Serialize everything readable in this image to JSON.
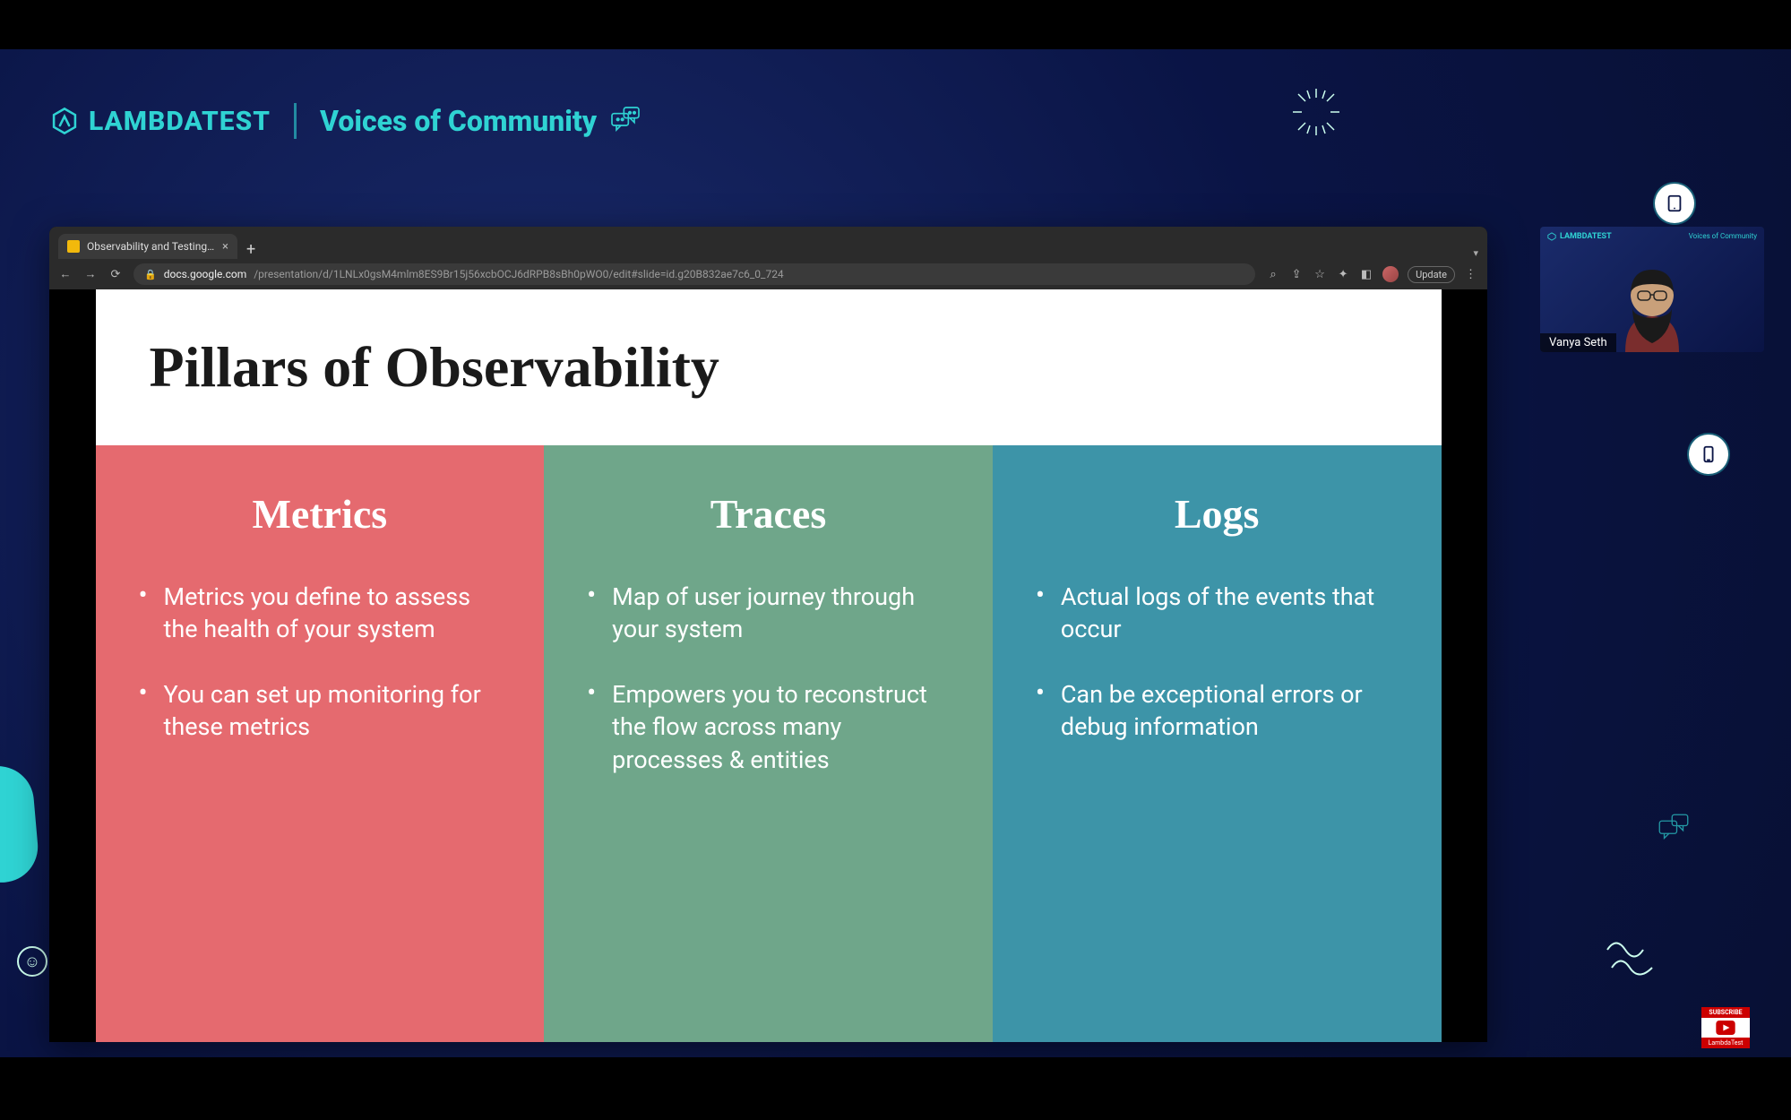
{
  "brand": {
    "name": "LAMBDATEST",
    "series": "Voices of Community"
  },
  "browser": {
    "tab_title": "Observability and Testing in P…",
    "url_domain": "docs.google.com",
    "url_path": "/presentation/d/1LNLx0gsM4mlm8ES9Br15j56xcbOCJ6dRPB8sBh0pWO0/edit#slide=id.g20B832ae7c6_0_724",
    "update_label": "Update"
  },
  "slide": {
    "title": "Pillars of Observability",
    "pillars": [
      {
        "heading": "Metrics",
        "bullets": [
          "Metrics you define to assess the health of your system",
          "You can set up monitoring for these metrics"
        ]
      },
      {
        "heading": "Traces",
        "bullets": [
          "Map of user journey through your system",
          "Empowers you to reconstruct the flow across many processes & entities"
        ]
      },
      {
        "heading": "Logs",
        "bullets": [
          "Actual logs of the events that occur",
          "Can be exceptional errors or debug information"
        ]
      }
    ]
  },
  "speaker": {
    "name": "Vanya Seth",
    "pip_brand": "LAMBDATEST",
    "pip_series": "Voices of Community"
  },
  "subscribe": {
    "top": "SUBSCRIBE",
    "bottom": "LambdaTest"
  },
  "colors": {
    "teal": "#2fd3d3",
    "metrics": "#e56a6f",
    "traces": "#6fa68a",
    "logs": "#3d94a8"
  }
}
